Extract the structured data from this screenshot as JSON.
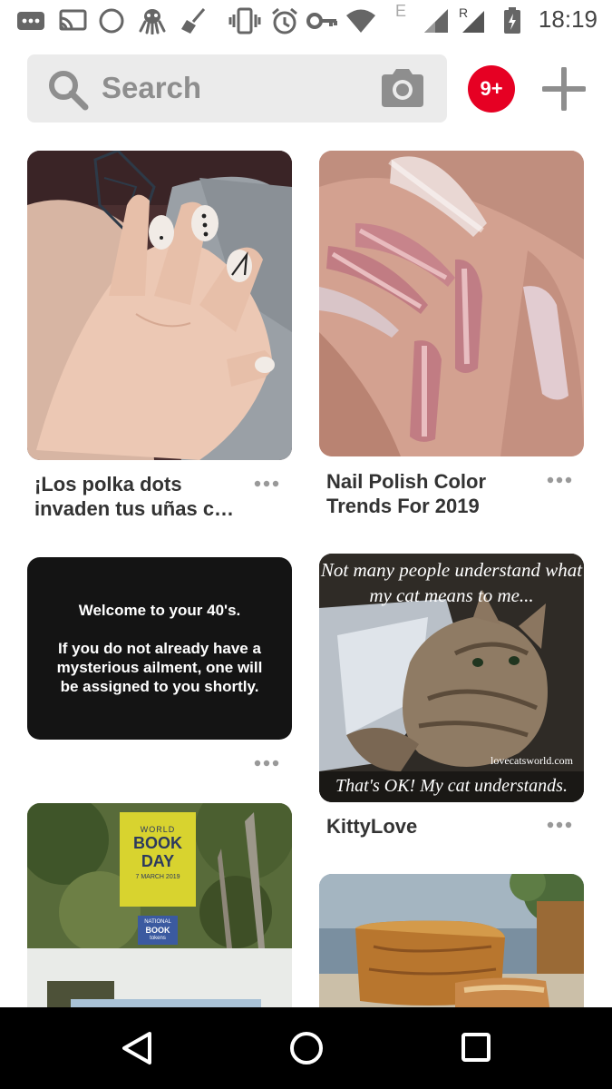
{
  "status_bar": {
    "time": "18:19",
    "network_label_e": "E",
    "network_label_r": "R",
    "icons": [
      "message-icon",
      "cast-icon",
      "night-mode-icon",
      "octopus-icon",
      "broom-icon",
      "vibrate-icon",
      "alarm-icon",
      "key-icon",
      "wifi-icon",
      "signal-icon",
      "signal-roaming-icon",
      "battery-charging-icon"
    ]
  },
  "header": {
    "search_placeholder": "Search",
    "notification_count": "9+"
  },
  "pins": [
    {
      "title": "¡Los polka dots invaden tus uñas c…",
      "image": "nail-art-polka-dots-image"
    },
    {
      "title": "Nail Polish Color Trends For 2019",
      "image": "rose-gold-glitter-nails-image"
    },
    {
      "title": "",
      "image": "dark-quote-card",
      "card_lines": [
        "Welcome to your 40's.",
        "If you do not already have a mysterious ailment, one will be assigned to you shortly."
      ]
    },
    {
      "title": "KittyLove",
      "image": "cat-meme-image",
      "top_text": "Not many people understand what my cat means to me...",
      "bottom_text": "That's OK! My cat understands.",
      "watermark": "lovecatsworld.com"
    },
    {
      "title": "",
      "image": "world-book-day-image",
      "badge_lines": [
        "WORLD",
        "BOOK",
        "DAY",
        "7 MARCH 2019"
      ],
      "tokens_lines": [
        "NATIONAL",
        "BOOK",
        "tokens"
      ]
    },
    {
      "title": "",
      "image": "banana-bread-image"
    }
  ],
  "colors": {
    "brand_red": "#e60023",
    "search_bg": "#ebebeb",
    "title_text": "#333333",
    "nav_bg": "#000000"
  },
  "nav": {
    "buttons": [
      "back-icon",
      "home-icon",
      "recents-icon"
    ]
  }
}
